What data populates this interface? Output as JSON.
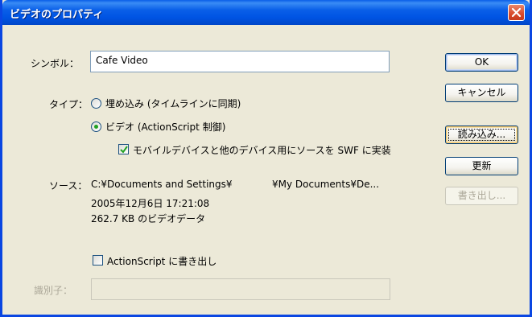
{
  "window": {
    "title": "ビデオのプロパティ"
  },
  "symbol": {
    "label": "シンボル：",
    "value": "Cafe Video"
  },
  "type": {
    "label": "タイプ：",
    "option_embed": "埋め込み (タイムラインに同期)",
    "option_video": "ビデオ (ActionScript 制御)",
    "selected": "video",
    "embed_option_checkbox": "モバイルデバイスと他のデバイス用にソースを SWF に実装",
    "embed_option_checked": true
  },
  "source": {
    "label": "ソース：",
    "path_left": "C:¥Documents and Settings¥",
    "path_right": "¥My Documents¥De...",
    "date": "2005年12月6日  17:21:08",
    "size_info": "262.7 KB のビデオデータ"
  },
  "export_actionscript": {
    "label": "ActionScript に書き出し",
    "checked": false
  },
  "identifier": {
    "label": "識別子：",
    "value": ""
  },
  "buttons": {
    "ok": "OK",
    "cancel": "キャンセル",
    "import": "読み込み...",
    "update": "更新",
    "export": "書き出し..."
  },
  "colors": {
    "titlebar": "#0054e3",
    "window_bg": "#ece9d8",
    "close_button": "#d8492a",
    "radio_dot": "#21a121",
    "disabled_text": "#aca899"
  }
}
